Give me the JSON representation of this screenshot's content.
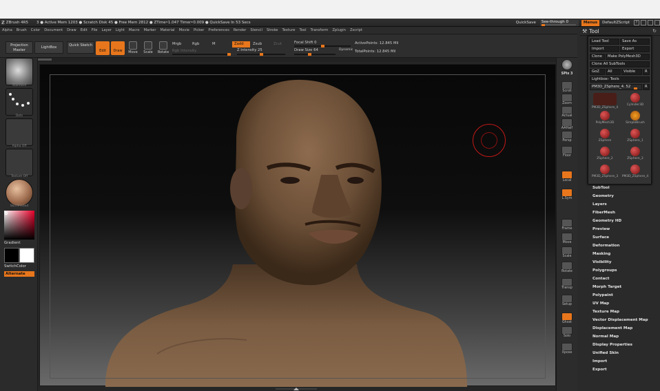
{
  "titlebar": {
    "app": "ZBrush 4R5",
    "info": "3   ● Active Mem 1203 ● Scratch Disk 45 ● Free Mem 2812 ● ZTime‣1.047 Timer‣0.009 ● QuickSave In 53 Secs",
    "quicksave": "QuickSave",
    "seethrough": "See-through 0",
    "menus": "Menus",
    "default_script": "DefaultZScript",
    "icon_help": "?"
  },
  "menubar": [
    "Alpha",
    "Brush",
    "Color",
    "Document",
    "Draw",
    "Edit",
    "File",
    "Layer",
    "Light",
    "Macro",
    "Marker",
    "Material",
    "Movie",
    "Picker",
    "Preferences",
    "Render",
    "Stencil",
    "Stroke",
    "Texture",
    "Tool",
    "Transform",
    "Zplugin",
    "Zscript"
  ],
  "toolbar": {
    "projection_master": "Projection Master",
    "lightbox": "LightBox",
    "quick_sketch": "Quick Sketch",
    "edit": "Edit",
    "draw": "Draw",
    "move": "Move",
    "scale": "Scale",
    "rotate": "Rotate",
    "mrgb": "Mrgb",
    "rgb": "Rgb",
    "m": "M",
    "rgb_intensity": "Rgb Intensity",
    "zadd": "Zadd",
    "zsub": "Zsub",
    "zcut": "Zcut",
    "z_intensity": "Z Intensity 25",
    "z_intensity_value": 25,
    "focal_shift": "Focal Shift 0",
    "draw_size": "Draw Size 64",
    "draw_size_value": 64,
    "dynamic": "Dynamic",
    "active_points": "ActivePoints: 12.845 Mil",
    "total_points": "TotalPoints: 12.845 Mil"
  },
  "leftpanel": {
    "brush_label": "Standard",
    "stroke_label": "Dots",
    "alpha_label": "Alpha Off",
    "texture_label": "Texture Off",
    "material_label": "SkinShade4",
    "gradient": "Gradient",
    "switch_color": "SwitchColor",
    "alternate": "Alternate"
  },
  "rightshelf": {
    "spix": "SPix 3",
    "items": [
      "Scroll",
      "Zoom",
      "Actual",
      "AAHalf",
      "Persp",
      "Floor",
      "Local",
      "L.Sym",
      "Frame",
      "Move",
      "Scale",
      "Rotate",
      "Transp",
      "Setup",
      "Ghost",
      "Solo",
      "Xpose"
    ]
  },
  "tray": {
    "title": "Tool",
    "load_tool": "Load Tool",
    "save_as": "Save As",
    "import": "Import",
    "export": "Export",
    "clone": "Clone",
    "make_polymesh": "Make PolyMesh3D",
    "clone_all": "Clone All SubTools",
    "goz": "GoZ",
    "all": "All",
    "visible": "Visible",
    "r": "R",
    "lightbox_tools": "Lightbox› Tools",
    "current_tool": "PM3D_ZSphere_4. 52",
    "thumbs": [
      "PM3D_ZSphere_4",
      "Cylinder3D",
      "PolyMesh3D",
      "SimpleBrush",
      "ZSphere",
      "ZSphere_1",
      "ZSphere_2",
      "ZSphere_3",
      "PM3D_ZSphere_3",
      "PM3D_ZSphere_4"
    ],
    "menu_items": [
      "SubTool",
      "Geometry",
      "Layers",
      "FiberMesh",
      "Geometry HD",
      "Preview",
      "Surface",
      "Deformation",
      "Masking",
      "Visibility",
      "Polygroups",
      "Contact",
      "Morph Target",
      "Polypaint",
      "UV Map",
      "Texture Map",
      "Vector Displacement Map",
      "Displacement Map",
      "Normal Map",
      "Display Properties",
      "Unified Skin",
      "Import",
      "Export"
    ]
  },
  "colors": {
    "accent": "#e8761c",
    "panel": "#2b2b2b",
    "skin": "#7a5a40"
  }
}
